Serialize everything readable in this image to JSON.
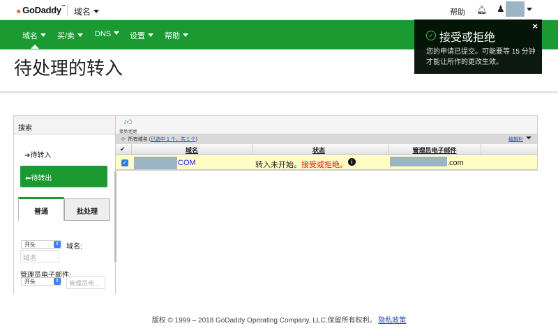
{
  "header": {
    "logo": "GoDaddy",
    "product": "域名",
    "help": "帮助"
  },
  "nav": {
    "items": [
      "域名",
      "买/卖",
      "DNS",
      "设置",
      "帮助"
    ]
  },
  "page_title": "待处理的转入",
  "left": {
    "header": "搜索",
    "incoming": "待转入",
    "outgoing": "待转出",
    "tabs": [
      "普通",
      "批处理"
    ],
    "domain_select": "开头",
    "domain_label": "域名:",
    "domain_placeholder": "域名",
    "email_label": "管理员电子邮件:",
    "email_select": "开头",
    "email_placeholder": "管理员电..."
  },
  "grid": {
    "accept_reject": "接受/拒绝",
    "all_domains": "所有域名",
    "selection": "已选中 1 个，共 1 个",
    "edit_columns": "编辑栏",
    "columns": [
      "域名",
      "状态",
      "管理员电子邮件"
    ],
    "rows": [
      {
        "checked": true,
        "domain_suffix": "COM",
        "status": "转入未开始。",
        "action": "接受或拒绝。",
        "email_suffix": ".com"
      }
    ]
  },
  "toast": {
    "title": "接受或拒绝",
    "body": "您的申请已提交。可能要等 15 分钟才能让所作的更改生效。"
  },
  "footer": {
    "copyright": "版权 © 1999 – 2018 GoDaddy Operating Company, LLC.保留所有权利。",
    "privacy": "隐私政策"
  },
  "colors": {
    "brand_green": "#1a9a31",
    "action_red": "#e8141c",
    "link_blue": "#2a4db5"
  }
}
